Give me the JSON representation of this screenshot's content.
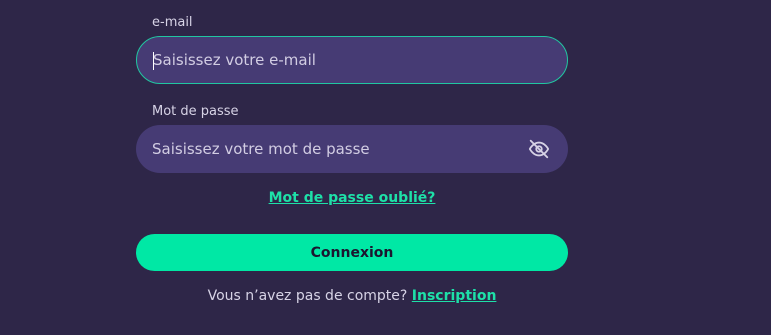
{
  "form": {
    "email": {
      "label": "e-mail",
      "placeholder": "Saisissez votre e-mail",
      "value": ""
    },
    "password": {
      "label": "Mot de passe",
      "placeholder": "Saisissez votre mot de passe",
      "value": "",
      "toggle_icon": "eye-off-icon"
    },
    "forgot_password_label": "Mot de passe oublié?",
    "submit_label": "Connexion",
    "signup_prompt": "Vous n’avez pas de compte?",
    "signup_link_label": "Inscription"
  },
  "colors": {
    "background": "#2e2648",
    "input_background": "#463b74",
    "focus_border": "#21c7a1",
    "accent": "#00e8a5",
    "accent_text": "#1ee0a8"
  }
}
